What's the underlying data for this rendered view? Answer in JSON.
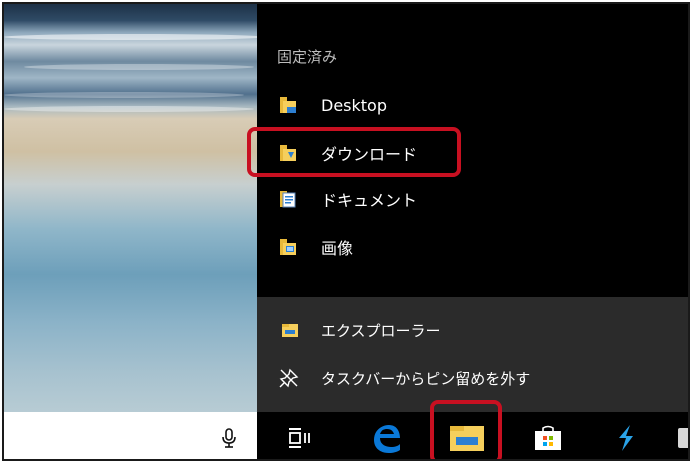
{
  "jump_list": {
    "pinned_header": "固定済み",
    "pinned_items": [
      {
        "label": "Desktop",
        "icon": "desktop-folder-icon"
      },
      {
        "label": "ダウンロード",
        "icon": "downloads-folder-icon"
      },
      {
        "label": "ドキュメント",
        "icon": "documents-folder-icon"
      },
      {
        "label": "画像",
        "icon": "pictures-folder-icon"
      }
    ],
    "tasks": [
      {
        "label": "エクスプローラー",
        "icon": "file-explorer-icon"
      },
      {
        "label": "タスクバーからピン留めを外す",
        "icon": "unpin-icon"
      }
    ]
  },
  "taskbar": {
    "icons": [
      "microphone-icon",
      "task-view-icon",
      "edge-icon",
      "file-explorer-icon",
      "store-icon",
      "app-icon"
    ]
  },
  "colors": {
    "highlight": "#c81021",
    "menu_bg": "#000000",
    "menu_bottom_bg": "#2b2b2b",
    "folder": "#f6cf5c",
    "edge": "#0a78d7"
  }
}
